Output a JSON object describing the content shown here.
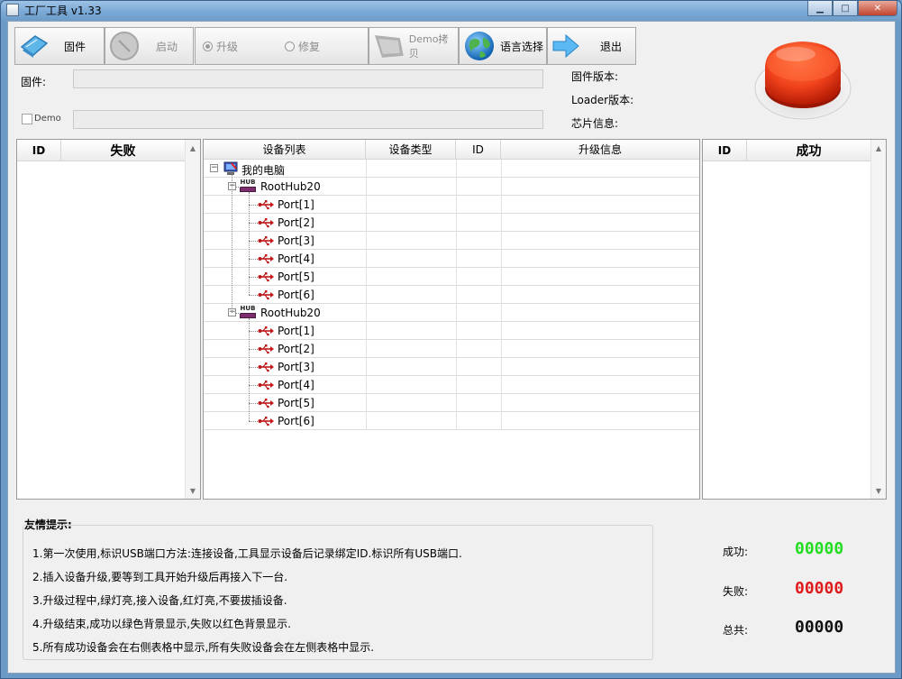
{
  "window": {
    "title": "工厂工具 v1.33"
  },
  "toolbar": {
    "firmware_label": "固件",
    "start_label": "启动",
    "upgrade_label": "升级",
    "repair_label": "修复",
    "demo_copy_label": "Demo拷贝",
    "language_label": "语言选择",
    "exit_label": "退出"
  },
  "fields": {
    "firmware_label": "固件:",
    "firmware_value": "",
    "demo_label": "Demo",
    "demo_value": "",
    "firmware_version_label": "固件版本:",
    "loader_version_label": "Loader版本:",
    "chip_info_label": "芯片信息:"
  },
  "fail_table": {
    "col_id": "ID",
    "col_fail": "失败"
  },
  "success_table": {
    "col_id": "ID",
    "col_success": "成功"
  },
  "device_list": {
    "headers": [
      "设备列表",
      "设备类型",
      "ID",
      "升级信息"
    ],
    "root": "我的电脑",
    "hubs": [
      {
        "name": "RootHub20",
        "ports": [
          "Port[1]",
          "Port[2]",
          "Port[3]",
          "Port[4]",
          "Port[5]",
          "Port[6]"
        ]
      },
      {
        "name": "RootHub20",
        "ports": [
          "Port[1]",
          "Port[2]",
          "Port[3]",
          "Port[4]",
          "Port[5]",
          "Port[6]"
        ]
      }
    ],
    "hub_icon_text": "HUB"
  },
  "tips": {
    "title": "友情提示:",
    "items": [
      "1.第一次使用,标识USB端口方法:连接设备,工具显示设备后记录绑定ID.标识所有USB端口.",
      "2.插入设备升级,要等到工具开始升级后再接入下一台.",
      "3.升级过程中,绿灯亮,接入设备,红灯亮,不要拔插设备.",
      "4.升级结束,成功以绿色背景显示,失败以红色背景显示.",
      "5.所有成功设备会在右侧表格中显示,所有失败设备会在左侧表格中显示."
    ]
  },
  "stats": {
    "success_label": "成功:",
    "success_value": "00000",
    "fail_label": "失败:",
    "fail_value": "00000",
    "total_label": "总共:",
    "total_value": "00000",
    "colors": {
      "success": "#22dd22",
      "fail": "#e01b1b",
      "total": "#111111"
    }
  }
}
